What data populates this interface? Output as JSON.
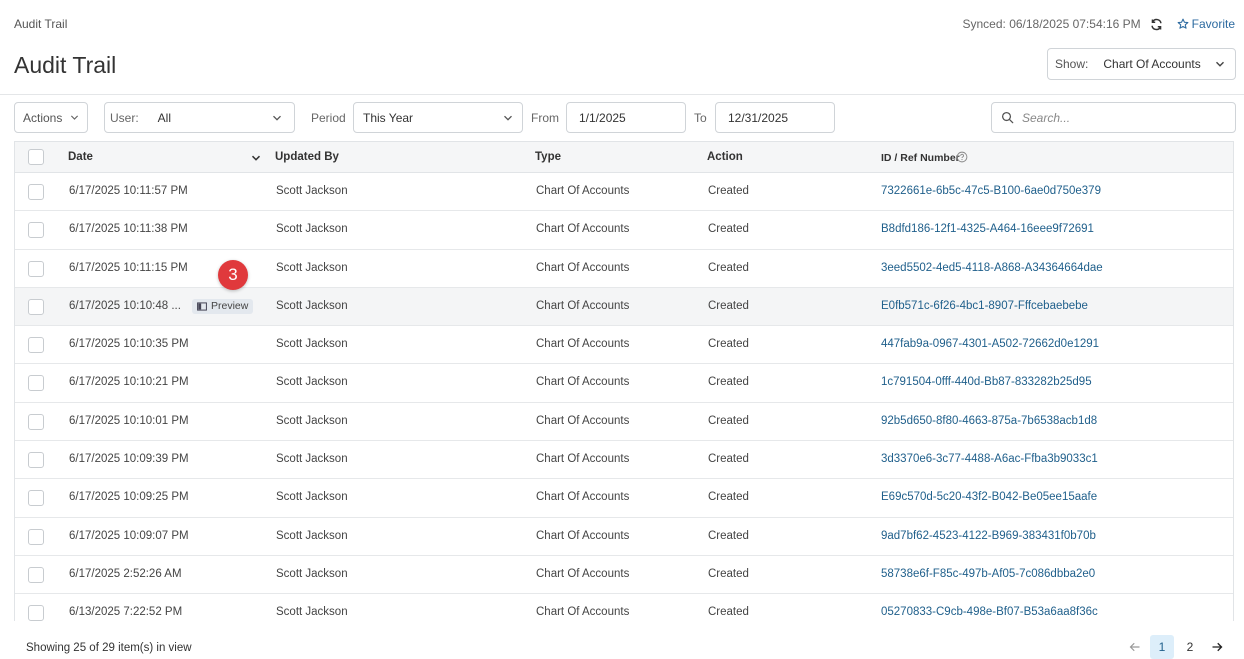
{
  "breadcrumb": "Audit Trail",
  "sync": {
    "text": "Synced: 06/18/2025 07:54:16 PM"
  },
  "favorite_label": "Favorite",
  "page_title": "Audit Trail",
  "show": {
    "label": "Show:",
    "value": "Chart Of Accounts"
  },
  "filters": {
    "actions_label": "Actions",
    "user_label": "User:",
    "user_value": "All",
    "period_label": "Period",
    "period_value": "This Year",
    "from_label": "From",
    "from_value": "1/1/2025",
    "to_label": "To",
    "to_value": "12/31/2025",
    "search_placeholder": "Search..."
  },
  "columns": {
    "date": "Date",
    "updated_by": "Updated By",
    "type": "Type",
    "action": "Action",
    "ref": "ID / Ref Number"
  },
  "rows": [
    {
      "date": "6/17/2025 10:11:57 PM",
      "updated_by": "Scott Jackson",
      "type": "Chart Of Accounts",
      "action": "Created",
      "ref": "7322661e-6b5c-47c5-B100-6ae0d750e379"
    },
    {
      "date": "6/17/2025 10:11:38 PM",
      "updated_by": "Scott Jackson",
      "type": "Chart Of Accounts",
      "action": "Created",
      "ref": "B8dfd186-12f1-4325-A464-16eee9f72691"
    },
    {
      "date": "6/17/2025 10:11:15 PM",
      "updated_by": "Scott Jackson",
      "type": "Chart Of Accounts",
      "action": "Created",
      "ref": "3eed5502-4ed5-4118-A868-A34364664dae"
    },
    {
      "date": "6/17/2025 10:10:48 ...",
      "updated_by": "Scott Jackson",
      "type": "Chart Of Accounts",
      "action": "Created",
      "ref": "E0fb571c-6f26-4bc1-8907-Fffcebaebebe"
    },
    {
      "date": "6/17/2025 10:10:35 PM",
      "updated_by": "Scott Jackson",
      "type": "Chart Of Accounts",
      "action": "Created",
      "ref": "447fab9a-0967-4301-A502-72662d0e1291"
    },
    {
      "date": "6/17/2025 10:10:21 PM",
      "updated_by": "Scott Jackson",
      "type": "Chart Of Accounts",
      "action": "Created",
      "ref": "1c791504-0fff-440d-Bb87-833282b25d95"
    },
    {
      "date": "6/17/2025 10:10:01 PM",
      "updated_by": "Scott Jackson",
      "type": "Chart Of Accounts",
      "action": "Created",
      "ref": "92b5d650-8f80-4663-875a-7b6538acb1d8"
    },
    {
      "date": "6/17/2025 10:09:39 PM",
      "updated_by": "Scott Jackson",
      "type": "Chart Of Accounts",
      "action": "Created",
      "ref": "3d3370e6-3c77-4488-A6ac-Ffba3b9033c1"
    },
    {
      "date": "6/17/2025 10:09:25 PM",
      "updated_by": "Scott Jackson",
      "type": "Chart Of Accounts",
      "action": "Created",
      "ref": "E69c570d-5c20-43f2-B042-Be05ee15aafe"
    },
    {
      "date": "6/17/2025 10:09:07 PM",
      "updated_by": "Scott Jackson",
      "type": "Chart Of Accounts",
      "action": "Created",
      "ref": "9ad7bf62-4523-4122-B969-383431f0b70b"
    },
    {
      "date": "6/17/2025 2:52:26 AM",
      "updated_by": "Scott Jackson",
      "type": "Chart Of Accounts",
      "action": "Created",
      "ref": "58738e6f-F85c-497b-Af05-7c086dbba2e0"
    },
    {
      "date": "6/13/2025 7:22:52 PM",
      "updated_by": "Scott Jackson",
      "type": "Chart Of Accounts",
      "action": "Created",
      "ref": "05270833-C9cb-498e-Bf07-B53a6aa8f36c"
    }
  ],
  "hover_preview_label": "Preview",
  "step_badge": "3",
  "footer": {
    "showing": "Showing 25 of 29 item(s) in view"
  },
  "pagination": {
    "pages": [
      "1",
      "2"
    ],
    "current": "1"
  },
  "colors": {
    "link": "#1f5f8b",
    "badge": "#e0393c",
    "accent": "#2c6aa0"
  },
  "icons": [
    "sync-icon",
    "star-icon",
    "chevron-down-icon",
    "search-icon",
    "help-icon",
    "preview-icon",
    "arrow-left-icon",
    "arrow-right-icon"
  ]
}
